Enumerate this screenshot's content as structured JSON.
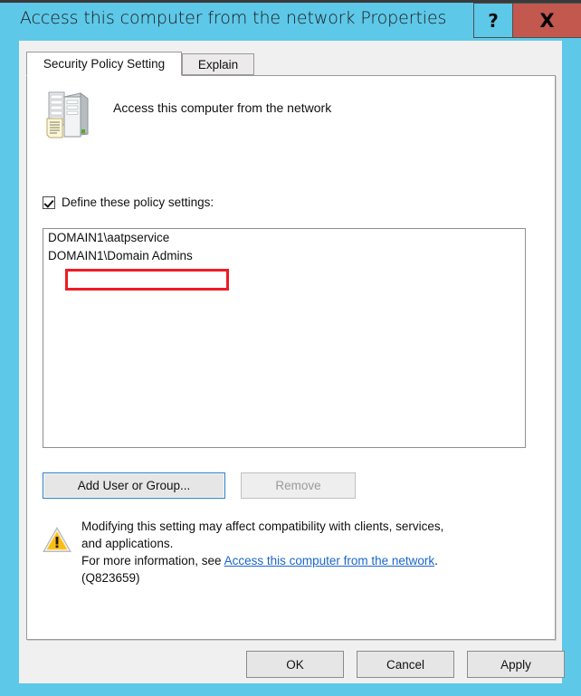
{
  "window": {
    "title": "Access this computer from the network Properties",
    "help_button_label": "?",
    "close_button_label": "X",
    "titlebar_color": "#5ec8e8",
    "close_button_color": "#c3584e"
  },
  "tabs": [
    {
      "label": "Security Policy Setting",
      "active": true
    },
    {
      "label": "Explain",
      "active": false
    }
  ],
  "policy": {
    "icon": "server-policy-icon",
    "name": "Access this computer from the network"
  },
  "define_setting": {
    "label": "Define these policy settings:",
    "checked": true
  },
  "accounts": {
    "items": [
      {
        "name": "DOMAIN1\\aatpservice",
        "annotated": true
      },
      {
        "name": "DOMAIN1\\Domain Admins",
        "annotated": false
      }
    ]
  },
  "annotation": {
    "color": "#ee1c24",
    "target": "DOMAIN1\\aatpservice"
  },
  "list_buttons": {
    "add_label": "Add User or Group...",
    "remove_label": "Remove",
    "remove_enabled": false,
    "add_focused": true
  },
  "warning": {
    "icon": "warning-triangle-icon",
    "line1": "Modifying this setting may affect compatibility with clients, services,",
    "line2": "and applications.",
    "line3_prefix": "For more information, see ",
    "link_text": "Access this computer from the network",
    "line3_suffix": ".",
    "line4": "(Q823659)",
    "link_color": "#1a66c9"
  },
  "footer": {
    "ok_label": "OK",
    "cancel_label": "Cancel",
    "apply_label": "Apply"
  }
}
